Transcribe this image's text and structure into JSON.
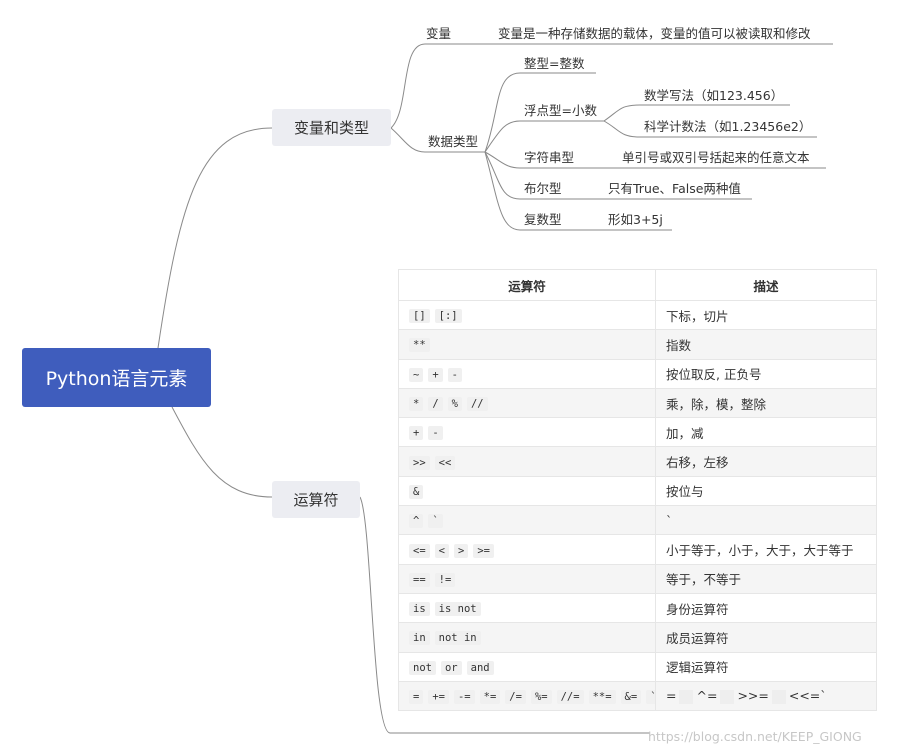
{
  "root": {
    "label": "Python语言元素"
  },
  "branches": {
    "vars": {
      "label": "变量和类型"
    },
    "ops": {
      "label": "运算符"
    }
  },
  "variable": {
    "label": "变量",
    "desc": "变量是一种存储数据的载体，变量的值可以被读取和修改"
  },
  "datatypes": {
    "label": "数据类型",
    "int": {
      "label": "整型=整数"
    },
    "float": {
      "label": "浮点型=小数",
      "notation1": "数学写法（如123.456）",
      "notation2": "科学计数法（如1.23456e2）"
    },
    "str": {
      "label": "字符串型",
      "desc": "单引号或双引号括起来的任意文本"
    },
    "bool": {
      "label": "布尔型",
      "desc": "只有True、False两种值"
    },
    "complex": {
      "label": "复数型",
      "desc": "形如3+5j"
    }
  },
  "table": {
    "headers": [
      "运算符",
      "描述"
    ],
    "rows": [
      {
        "ops": [
          "[]",
          "[:]"
        ],
        "desc": "下标，切片"
      },
      {
        "ops": [
          "**"
        ],
        "desc": "指数"
      },
      {
        "ops": [
          "~",
          "+",
          "-"
        ],
        "desc": "按位取反, 正负号"
      },
      {
        "ops": [
          "*",
          "/",
          "%",
          "//"
        ],
        "desc": "乘，除，模，整除"
      },
      {
        "ops": [
          "+",
          "-"
        ],
        "desc": "加，减"
      },
      {
        "ops": [
          ">>",
          "<<"
        ],
        "desc": "右移，左移"
      },
      {
        "ops": [
          "&"
        ],
        "desc": "按位与"
      },
      {
        "ops": [
          "^",
          "`"
        ],
        "desc": "`"
      },
      {
        "ops": [
          "<=",
          "<",
          ">",
          ">="
        ],
        "desc": "小于等于，小于，大于，大于等于"
      },
      {
        "ops": [
          "==",
          "!="
        ],
        "desc": "等于，不等于"
      },
      {
        "ops": [
          "is",
          "is not"
        ],
        "desc": "身份运算符"
      },
      {
        "ops": [
          "in",
          "not in"
        ],
        "desc": "成员运算符"
      },
      {
        "ops": [
          "not",
          "or",
          "and"
        ],
        "desc": "逻辑运算符"
      },
      {
        "ops": [
          "=",
          "+=",
          "-=",
          "*=",
          "/=",
          "%=",
          "//=",
          "**=",
          "&=",
          "`"
        ],
        "desc": [
          "=",
          "^=",
          ">>=",
          "<<=`"
        ]
      }
    ]
  },
  "watermark": "https://blog.csdn.net/KEEP_GIONG"
}
